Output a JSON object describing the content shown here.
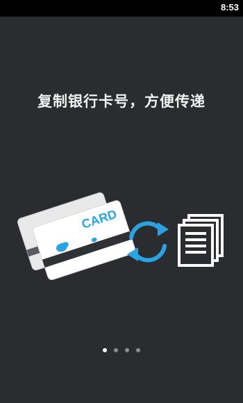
{
  "status_bar": {
    "time": "8:53"
  },
  "onboarding": {
    "headline": "复制银行卡号，方便传递",
    "card_text": "CARD",
    "page_indicator": {
      "total": 4,
      "current": 1
    }
  },
  "colors": {
    "background": "#2a2c30",
    "accent_blue": "#2aa3e0",
    "white": "#ffffff"
  },
  "icons": [
    "bank-card-icon",
    "sync-arrows-icon",
    "copy-documents-icon"
  ]
}
